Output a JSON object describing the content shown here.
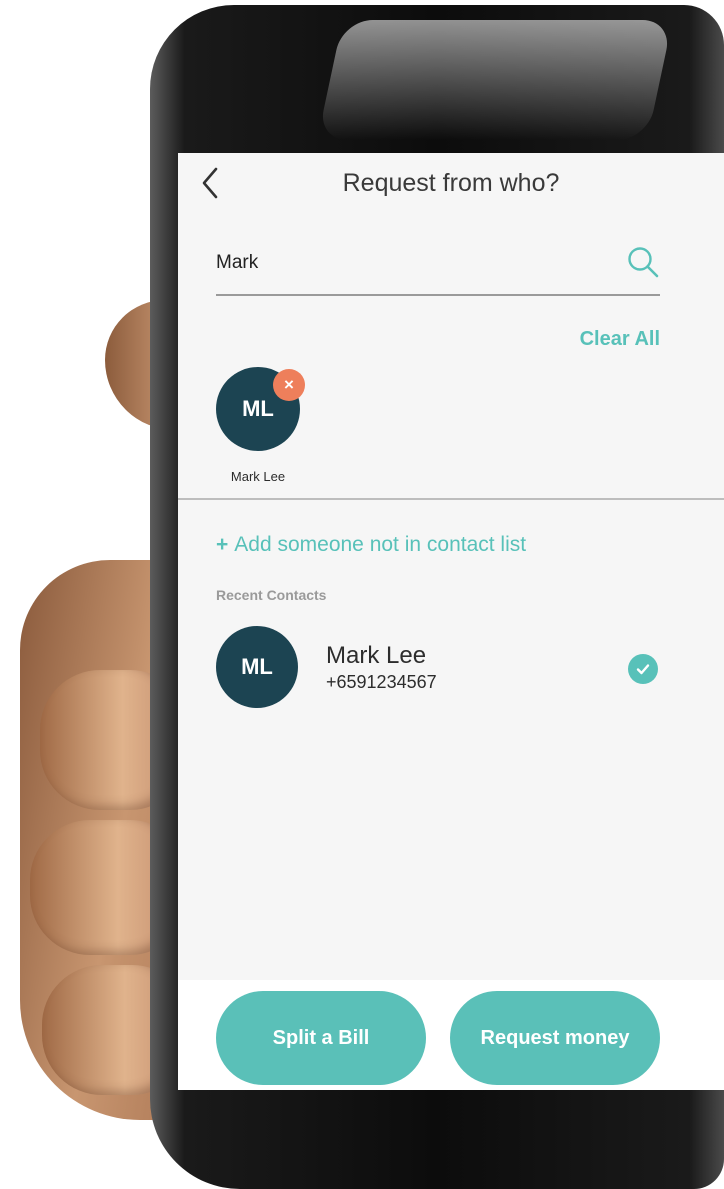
{
  "header": {
    "title": "Request from who?",
    "back_icon": "chevron-left-icon"
  },
  "search": {
    "value": "Mark",
    "icon": "search-icon"
  },
  "selection": {
    "clear_all_label": "Clear All",
    "selected": [
      {
        "initials": "ML",
        "name": "Mark Lee",
        "remove_icon": "close-icon"
      }
    ]
  },
  "add_contact": {
    "plus": "+",
    "label": "Add someone not in contact list"
  },
  "recent": {
    "heading": "Recent Contacts",
    "contacts": [
      {
        "initials": "ML",
        "name": "Mark Lee",
        "phone": "+6591234567",
        "selected": true,
        "check_icon": "check-icon"
      }
    ]
  },
  "actions": {
    "split_label": "Split a Bill",
    "request_label": "Request money"
  },
  "colors": {
    "accent": "#5ac0b8",
    "avatar": "#1c4452",
    "remove_badge": "#ee7f5b",
    "screen_bg": "#f6f6f6"
  }
}
